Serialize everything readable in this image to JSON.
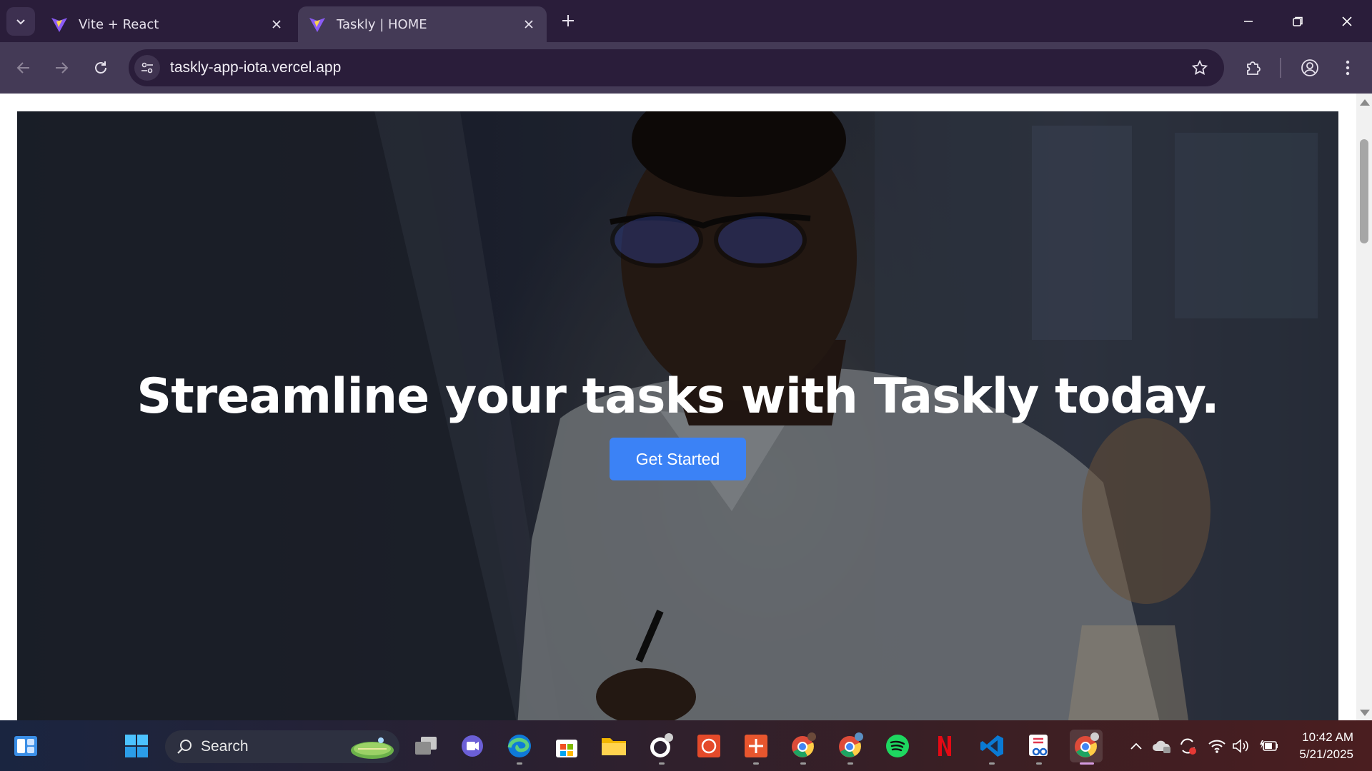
{
  "browser": {
    "tabs": [
      {
        "title": "Vite + React",
        "active": false
      },
      {
        "title": "Taskly | HOME",
        "active": true
      }
    ],
    "url": "taskly-app-iota.vercel.app"
  },
  "page": {
    "hero_title": "Streamline your tasks with Taskly today.",
    "cta_label": "Get Started"
  },
  "taskbar": {
    "search_label": "Search",
    "apps": [
      "task-view",
      "teams-meet",
      "edge",
      "microsoft-store",
      "file-explorer",
      "github-desktop",
      "app-red-1",
      "app-red-2",
      "chrome-profile-1",
      "chrome-profile-2",
      "spotify",
      "netflix",
      "vscode",
      "snipping-tool",
      "chrome-active"
    ],
    "clock_time": "10:42 AM",
    "clock_date": "5/21/2025"
  },
  "colors": {
    "titlebar": "#2a1d3a",
    "toolbar": "#443a56",
    "cta": "#3b82f6"
  }
}
